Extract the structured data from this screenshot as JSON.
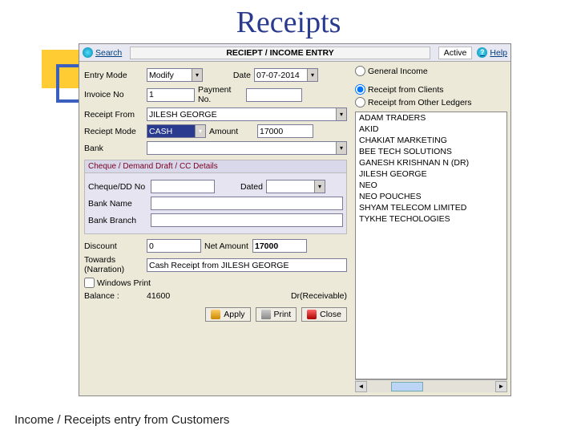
{
  "slide": {
    "title": "Receipts",
    "caption": "Income / Receipts entry from Customers"
  },
  "topbar": {
    "search": "Search",
    "title": "RECIEPT / INCOME ENTRY",
    "status": "Active",
    "help": "Help"
  },
  "radios": {
    "general": "General Income",
    "clients": "Receipt from Clients",
    "other": "Receipt from Other Ledgers"
  },
  "form": {
    "entry_mode_lbl": "Entry Mode",
    "entry_mode_val": "Modify",
    "date_lbl": "Date",
    "date_val": "07-07-2014",
    "invno_lbl": "Invoice No",
    "invno_val": "1",
    "payno_lbl": "Payment No.",
    "payno_val": "",
    "from_lbl": "Receipt From",
    "from_val": "JILESH GEORGE",
    "mode_lbl": "Reciept Mode",
    "mode_val": "CASH",
    "amount_lbl": "Amount",
    "amount_val": "17000",
    "bank_lbl": "Bank",
    "bank_val": ""
  },
  "cheque": {
    "section": "Cheque / Demand Draft / CC  Details",
    "chqno_lbl": "Cheque/DD No",
    "chqno_val": "",
    "dated_lbl": "Dated",
    "dated_val": "",
    "bankname_lbl": "Bank Name",
    "bankname_val": "",
    "branch_lbl": "Bank Branch",
    "branch_val": ""
  },
  "totals": {
    "discount_lbl": "Discount",
    "discount_val": "0",
    "netamt_lbl": "Net Amount",
    "netamt_val": "17000",
    "towards_lbl": "Towards (Narration)",
    "towards_val": "Cash Receipt from JILESH GEORGE",
    "winprint_lbl": "Windows Print",
    "balance_lbl": "Balance :",
    "balance_val": "41600",
    "drcr": "Dr(Receivable)"
  },
  "buttons": {
    "apply": "Apply",
    "print": "Print",
    "close": "Close"
  },
  "clients": [
    "ADAM TRADERS",
    "AKID",
    "CHAKIAT MARKETING",
    "BEE TECH SOLUTIONS",
    "GANESH KRISHNAN N (DR)",
    "JILESH GEORGE",
    "NEO",
    "NEO POUCHES",
    "SHYAM TELECOM LIMITED",
    "TYKHE TECHOLOGIES"
  ]
}
